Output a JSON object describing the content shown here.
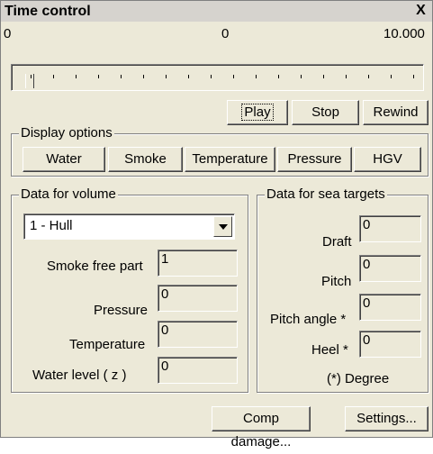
{
  "window": {
    "title": "Time control",
    "close_label": "X"
  },
  "timeline": {
    "start": "0",
    "current": "0",
    "end": "10.000",
    "position": 0
  },
  "playback": {
    "play": "Play",
    "stop": "Stop",
    "rewind": "Rewind"
  },
  "display_options": {
    "title": "Display options",
    "buttons": [
      "Water",
      "Smoke",
      "Temperature",
      "Pressure",
      "HGV"
    ]
  },
  "volume": {
    "title": "Data for volume",
    "selected": "1 - Hull",
    "smoke_free_label": "Smoke free part",
    "smoke_free_value": "1",
    "pressure_label": "Pressure",
    "pressure_value": "0",
    "temperature_label": "Temperature",
    "temperature_value": "0",
    "water_level_label": "Water level ( z )",
    "water_level_value": "0"
  },
  "sea_targets": {
    "title": "Data for sea targets",
    "draft_label": "Draft",
    "draft_value": "0",
    "pitch_label": "Pitch",
    "pitch_value": "0",
    "pitch_angle_label": "Pitch angle *",
    "pitch_angle_value": "0",
    "heel_label": "Heel *",
    "heel_value": "0",
    "footnote": "(*) Degree"
  },
  "bottom": {
    "comp_damage": "Comp damage...",
    "settings": "Settings..."
  }
}
